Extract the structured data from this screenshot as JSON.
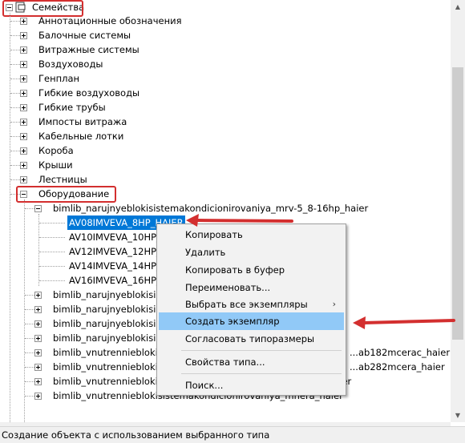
{
  "tree": {
    "root": {
      "label": "Семейства"
    },
    "categories": [
      "Аннотационные обозначения",
      "Балочные системы",
      "Витражные системы",
      "Воздуховоды",
      "Генплан",
      "Гибкие воздуховоды",
      "Гибкие трубы",
      "Импосты витража",
      "Кабельные лотки",
      "Короба",
      "Крыши",
      "Лестницы"
    ],
    "expanded_category": {
      "label": "Оборудование"
    },
    "expanded_family": {
      "label": "bimlib_narujnyeblokisistemakondicionirovaniya_mrv-5_8-16hp_haier"
    },
    "types": [
      "AV08IMVEVA_8HP_HAIER",
      "AV10IMVEVA_10HP_",
      "AV12IMVEVA_12HP_",
      "AV14IMVEVA_14HP_",
      "AV16IMVEVA_16HP_"
    ],
    "families_after": [
      {
        "text": "bimlib_narujnyeblokisi",
        "suffix": ""
      },
      {
        "text": "bimlib_narujnyeblokisi",
        "suffix": ""
      },
      {
        "text": "bimlib_narujnyeblokisi",
        "suffix": ""
      },
      {
        "text": "bimlib_narujnyeblokisi",
        "suffix": ""
      },
      {
        "text": "bimlib_vnutrennieblokisi",
        "suffix": "...ab182mcerac_haier"
      },
      {
        "text": "bimlib_vnutrennieblokisi",
        "suffix": "...ab282mcera_haier"
      },
      {
        "text": "bimlib_vnutrennieblokisistemakondicionirovaniya_mcerum_haier",
        "suffix": ""
      },
      {
        "text": "bimlib_vnutrennieblokisistemakondicionirovaniya_mhera_haier",
        "suffix": ""
      }
    ]
  },
  "context_menu": {
    "items": [
      {
        "label": "Копировать"
      },
      {
        "label": "Удалить"
      },
      {
        "label": "Копировать в буфер"
      },
      {
        "label": "Переименовать..."
      },
      {
        "label": "Выбрать все экземпляры",
        "submenu": "›"
      },
      {
        "label": "Создать экземпляр"
      },
      {
        "label": "Согласовать типоразмеры"
      },
      {
        "label": "Свойства типа..."
      },
      {
        "label": "Поиск..."
      }
    ]
  },
  "status_bar": {
    "text": "Создание объекта с использованием выбранного типа"
  },
  "colors": {
    "highlight_box": "#d32f2f",
    "selection": "#0078d7",
    "menu_hover": "#91c9f7"
  }
}
